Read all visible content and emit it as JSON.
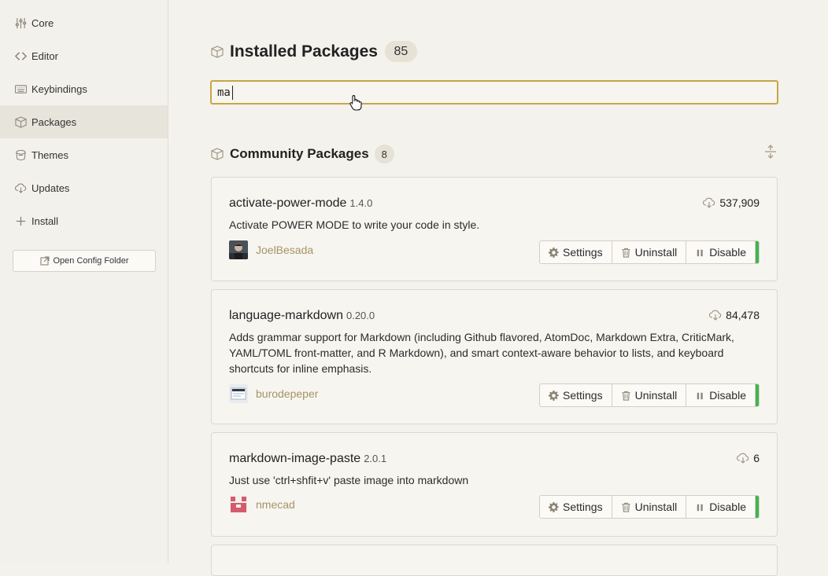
{
  "sidebar": {
    "items": [
      {
        "label": "Core",
        "icon": "sliders-icon"
      },
      {
        "label": "Editor",
        "icon": "code-icon"
      },
      {
        "label": "Keybindings",
        "icon": "keyboard-icon"
      },
      {
        "label": "Packages",
        "icon": "package-icon",
        "active": true
      },
      {
        "label": "Themes",
        "icon": "paintcan-icon"
      },
      {
        "label": "Updates",
        "icon": "cloud-download-icon"
      },
      {
        "label": "Install",
        "icon": "plus-icon"
      }
    ],
    "config_button": "Open Config Folder"
  },
  "installed": {
    "title": "Installed Packages",
    "count": "85",
    "search_value": "ma"
  },
  "community": {
    "title": "Community Packages",
    "count": "8"
  },
  "buttons": {
    "settings": "Settings",
    "uninstall": "Uninstall",
    "disable": "Disable"
  },
  "packages": [
    {
      "name": "activate-power-mode",
      "version": "1.4.0",
      "downloads": "537,909",
      "description": "Activate POWER MODE to write your code in style.",
      "author": "JoelBesada"
    },
    {
      "name": "language-markdown",
      "version": "0.20.0",
      "downloads": "84,478",
      "description": "Adds grammar support for Markdown (including Github flavored, AtomDoc, Markdown Extra, CriticMark, YAML/TOML front-matter, and R Markdown), and smart context-aware behavior to lists, and keyboard shortcuts for inline emphasis.",
      "author": "burodepeper"
    },
    {
      "name": "markdown-image-paste",
      "version": "2.0.1",
      "downloads": "6",
      "description": "Just use 'ctrl+shfit+v' paste image into markdown",
      "author": "nmecad"
    }
  ],
  "colors": {
    "accent": "#c7a648",
    "enabled": "#41b550",
    "author_link": "#a69465"
  }
}
